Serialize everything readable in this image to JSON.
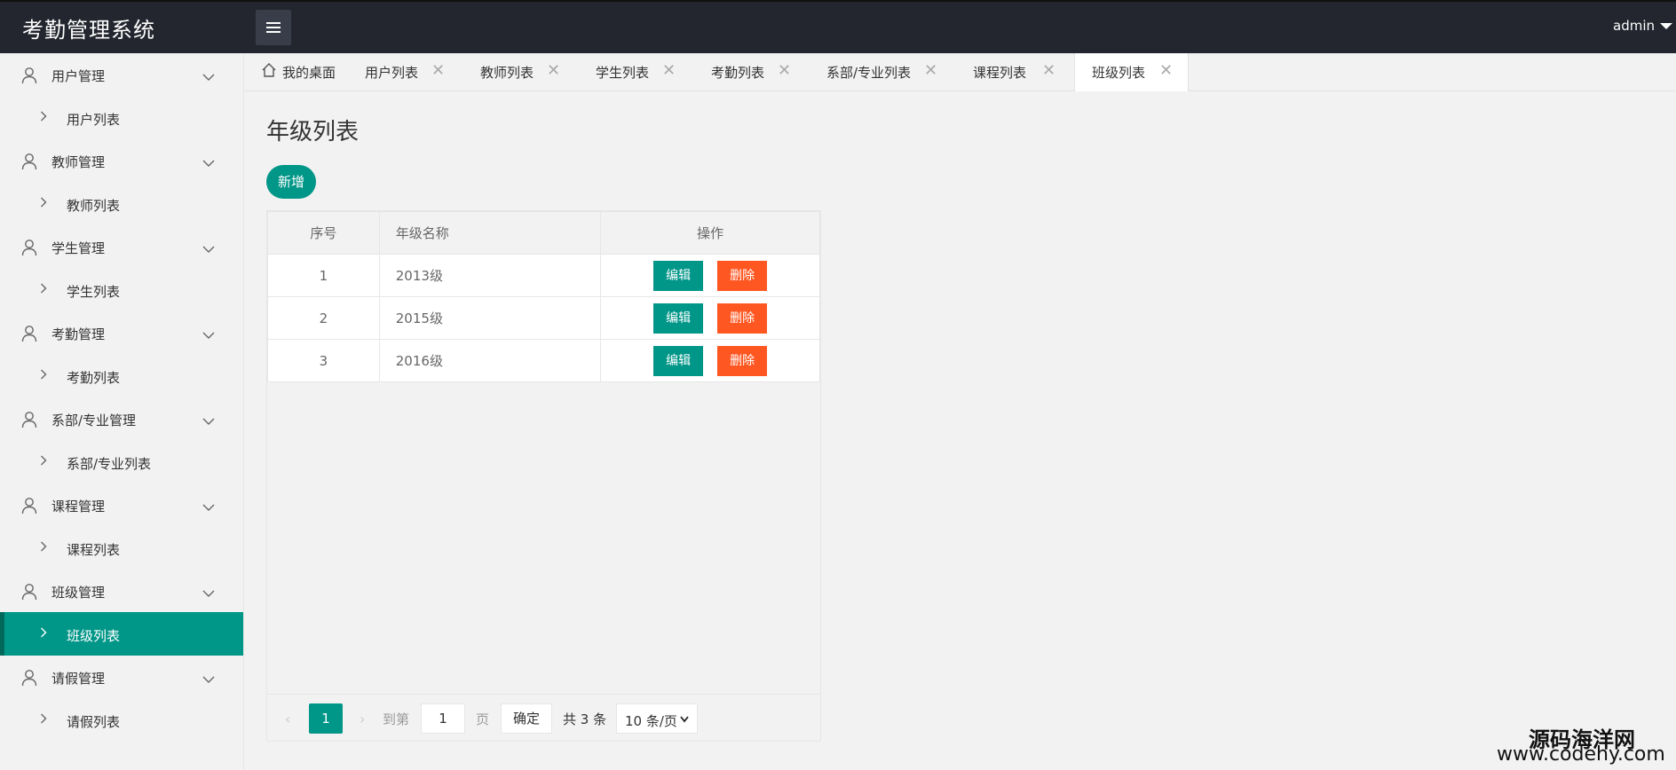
{
  "header": {
    "title": "考勤管理系统",
    "user": "admin"
  },
  "sidebar": {
    "groups": [
      {
        "label": "用户管理",
        "items": [
          "用户列表"
        ]
      },
      {
        "label": "教师管理",
        "items": [
          "教师列表"
        ]
      },
      {
        "label": "学生管理",
        "items": [
          "学生列表"
        ]
      },
      {
        "label": "考勤管理",
        "items": [
          "考勤列表"
        ]
      },
      {
        "label": "系部/专业管理",
        "items": [
          "系部/专业列表"
        ]
      },
      {
        "label": "课程管理",
        "items": [
          "课程列表"
        ]
      },
      {
        "label": "班级管理",
        "items": [
          "班级列表"
        ]
      },
      {
        "label": "请假管理",
        "items": [
          "请假列表"
        ]
      }
    ],
    "active_item": "班级列表"
  },
  "tabs": [
    {
      "label": "我的桌面",
      "closable": false
    },
    {
      "label": "用户列表",
      "closable": true
    },
    {
      "label": "教师列表",
      "closable": true
    },
    {
      "label": "学生列表",
      "closable": true
    },
    {
      "label": "考勤列表",
      "closable": true
    },
    {
      "label": "系部/专业列表",
      "closable": true
    },
    {
      "label": "课程列表",
      "closable": true
    },
    {
      "label": "班级列表",
      "closable": true,
      "active": true
    }
  ],
  "tab_close_glyph": "✕",
  "main": {
    "title": "年级列表",
    "add_label": "新增",
    "table": {
      "columns": [
        "序号",
        "年级名称",
        "操作"
      ],
      "rows": [
        {
          "id": "1",
          "name": "2013级"
        },
        {
          "id": "2",
          "name": "2015级"
        },
        {
          "id": "3",
          "name": "2016级"
        }
      ],
      "edit_label": "编辑",
      "delete_label": "删除"
    },
    "pager": {
      "current": "1",
      "goto_label": "到第",
      "goto_value": "1",
      "page_label": "页",
      "confirm_label": "确定",
      "total_label": "共 3 条",
      "page_size_label": "10 条/页"
    }
  },
  "watermark": {
    "cn": "源码海洋网",
    "en": "www.codehy.com"
  },
  "colors": {
    "header_bg": "#23262e",
    "accent": "#009688",
    "danger": "#ff5722"
  }
}
